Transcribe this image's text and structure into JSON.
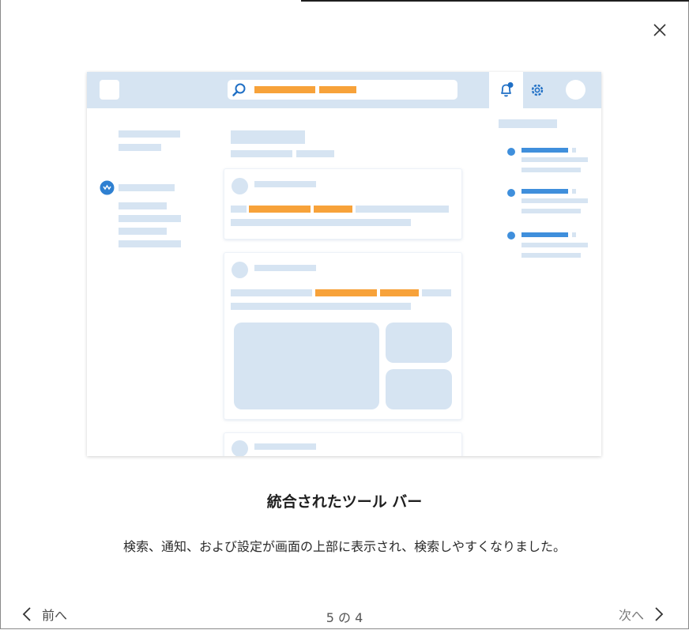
{
  "dialog": {
    "title": "統合されたツール バー",
    "description": "検索、通知、および設定が画面の上部に表示され、検索しやすくなりました。",
    "close_icon": "close-icon"
  },
  "navigation": {
    "prev_label": "前へ",
    "next_label": "次へ",
    "pager": "5 の 4",
    "prev_icon": "chevron-left-icon",
    "next_icon": "chevron-right-icon"
  },
  "colors": {
    "accent_orange": "#f7a23a",
    "accent_blue": "#3f8fdc",
    "placeholder": "#d6e4f2"
  },
  "illustration": {
    "icons": [
      "search-icon",
      "bell-icon",
      "gear-icon",
      "avatar",
      "feed-icon"
    ]
  }
}
